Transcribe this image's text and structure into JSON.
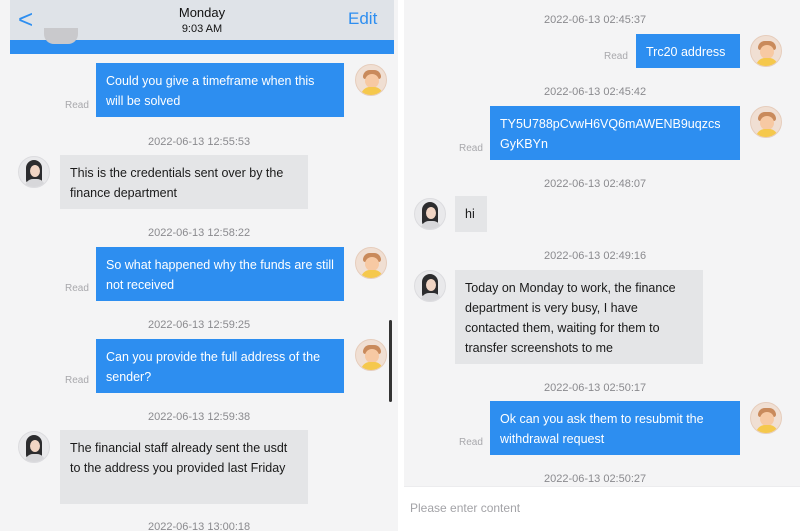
{
  "left": {
    "header": {
      "back_label": "<",
      "title": "Monday",
      "time": "9:03 AM",
      "edit_label": "Edit"
    },
    "messages": [
      {
        "dir": "out",
        "text": "Could you give a timeframe when this will be solved",
        "status": "Read"
      },
      {
        "timestamp": "2022-06-13 12:55:53",
        "dir": "in",
        "text": "This is the credentials sent over by the finance department"
      },
      {
        "timestamp": "2022-06-13 12:58:22",
        "dir": "out",
        "text": "So what happened why the funds are still not received",
        "status": "Read"
      },
      {
        "timestamp": "2022-06-13 12:59:25",
        "dir": "out",
        "text": "Can you provide the full address of the sender?",
        "status": "Read"
      },
      {
        "timestamp": "2022-06-13 12:59:38",
        "dir": "in",
        "text": "The financial staff already sent the usdt to the address you provided last Friday"
      },
      {
        "timestamp": "2022-06-13 13:00:18"
      }
    ]
  },
  "right": {
    "messages": [
      {
        "timestamp": "2022-06-13 02:45:37",
        "dir": "out",
        "text": "Trc20 address",
        "status": "Read"
      },
      {
        "timestamp": "2022-06-13 02:45:42",
        "dir": "out",
        "text": "TY5U788pCvwH6VQ6mAWENB9uqzcs GyKBYn",
        "status": "Read"
      },
      {
        "timestamp": "2022-06-13 02:48:07",
        "dir": "in",
        "text": "hi"
      },
      {
        "timestamp": "2022-06-13 02:49:16",
        "dir": "in",
        "text": "Today on Monday to work, the finance department is very busy, I have contacted them, waiting for them to transfer screenshots to me"
      },
      {
        "timestamp": "2022-06-13 02:50:17",
        "dir": "out",
        "text": "Ok can you ask them to resubmit the withdrawal request",
        "status": "Read"
      },
      {
        "timestamp": "2022-06-13 02:50:27"
      }
    ],
    "input": {
      "placeholder": "Please enter content"
    }
  },
  "colors": {
    "accent": "#2d8ef0",
    "incoming_bubble": "#e4e5e7",
    "background": "#f4f4f5"
  },
  "icons": {
    "back": "chevron-left-icon",
    "user_avatar": "user-avatar-icon",
    "agent_avatar": "agent-avatar-icon"
  }
}
